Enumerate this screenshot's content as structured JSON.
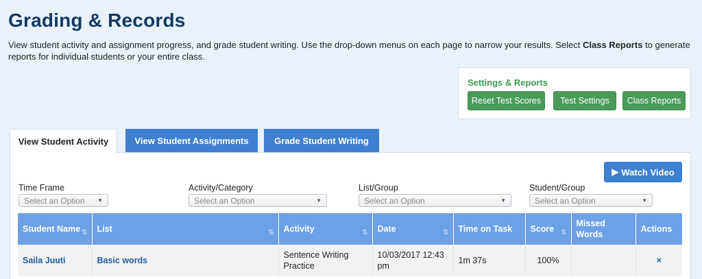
{
  "page": {
    "title": "Grading & Records",
    "intro_before": "View student activity and assignment progress, and grade student writing. Use the drop-down menus on each page to narrow your results. Select ",
    "intro_bold": "Class Reports",
    "intro_after": " to generate reports for individual students or your entire class."
  },
  "settings": {
    "title": "Settings & Reports",
    "buttons": [
      "Reset Test Scores",
      "Test Settings",
      "Class Reports"
    ]
  },
  "tabs": [
    "View Student Activity",
    "View Student Assignments",
    "Grade Student Writing"
  ],
  "watch_video": {
    "label": "Watch Video",
    "icon": "play-icon"
  },
  "filters": [
    {
      "label": "Time Frame",
      "placeholder": "Select an Option"
    },
    {
      "label": "Activity/Category",
      "placeholder": "Select an Option"
    },
    {
      "label": "List/Group",
      "placeholder": "Select an Option"
    },
    {
      "label": "Student/Group",
      "placeholder": "Select an Option"
    }
  ],
  "table": {
    "headers": [
      "Student Name",
      "List",
      "Activity",
      "Date",
      "Time on Task",
      "Score",
      "Missed Words",
      "Actions"
    ],
    "rows": [
      {
        "student": "Saila Juuti",
        "list": "Basic words",
        "activity": "Sentence Writing Practice",
        "date": "10/03/2017 12:43 pm",
        "time_on_task": "1m 37s",
        "score": "100%",
        "missed_words": "",
        "action_icon": "×"
      }
    ]
  },
  "colors": {
    "title": "#123a62",
    "accent_blue": "#3f7fd0",
    "green": "#4a9a58",
    "header_blue": "#6da0e6"
  }
}
